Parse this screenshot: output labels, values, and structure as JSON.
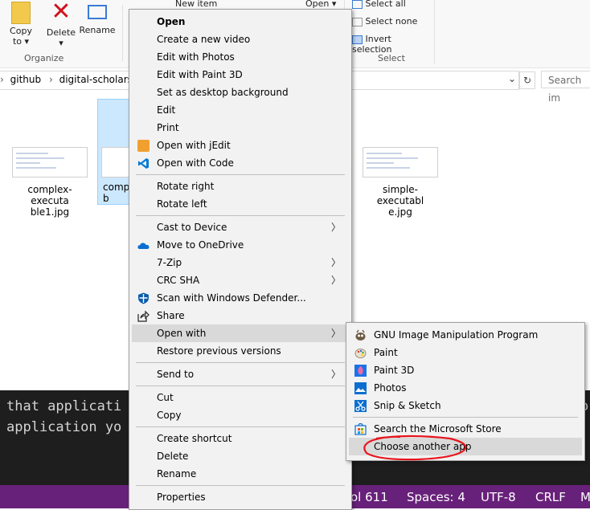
{
  "ribbon": {
    "copy_to": "Copy",
    "copy_to2": "to",
    "delete": "Delete",
    "rename": "Rename",
    "organize": "Organize",
    "new_item": "New item",
    "open": "Open",
    "select_all": "Select all",
    "select_none": "Select none",
    "invert_selection": "Invert selection",
    "select": "Select"
  },
  "address": {
    "crumb1": "github",
    "crumb2": "digital-scholarsh",
    "search_placeholder": "Search im"
  },
  "files": [
    {
      "name": "complex-executa ble1.jpg"
    },
    {
      "name": "comp b"
    },
    {
      "name": "simple-executabl e.jpg"
    }
  ],
  "terminal": {
    "line1": "that applicati",
    "line1_right": "o",
    "line2": "application yo"
  },
  "statusbar": {
    "col": "ol 611",
    "spaces": "Spaces: 4",
    "encoding": "UTF-8",
    "eol": "CRLF",
    "extra": "M"
  },
  "context_menu": {
    "open": "Open",
    "create_video": "Create a new video",
    "edit_photos": "Edit with Photos",
    "edit_paint3d": "Edit with Paint 3D",
    "set_bg": "Set as desktop background",
    "edit": "Edit",
    "print": "Print",
    "open_jedit": "Open with jEdit",
    "open_code": "Open with Code",
    "rotate_right": "Rotate right",
    "rotate_left": "Rotate left",
    "cast": "Cast to Device",
    "onedrive": "Move to OneDrive",
    "zip": "7-Zip",
    "crc": "CRC SHA",
    "defender": "Scan with Windows Defender...",
    "share": "Share",
    "open_with": "Open with",
    "restore": "Restore previous versions",
    "send_to": "Send to",
    "cut": "Cut",
    "copy": "Copy",
    "create_shortcut": "Create shortcut",
    "delete": "Delete",
    "rename": "Rename",
    "properties": "Properties"
  },
  "submenu": {
    "gimp": "GNU Image Manipulation Program",
    "paint": "Paint",
    "paint3d": "Paint 3D",
    "photos": "Photos",
    "snip": "Snip & Sketch",
    "store": "Search the Microsoft Store",
    "choose": "Choose another app"
  },
  "colors": {
    "status_bar": "#68217a",
    "terminal_bg": "#1e1e1e",
    "annotation": "#e8141c",
    "selection": "#cce8ff"
  }
}
